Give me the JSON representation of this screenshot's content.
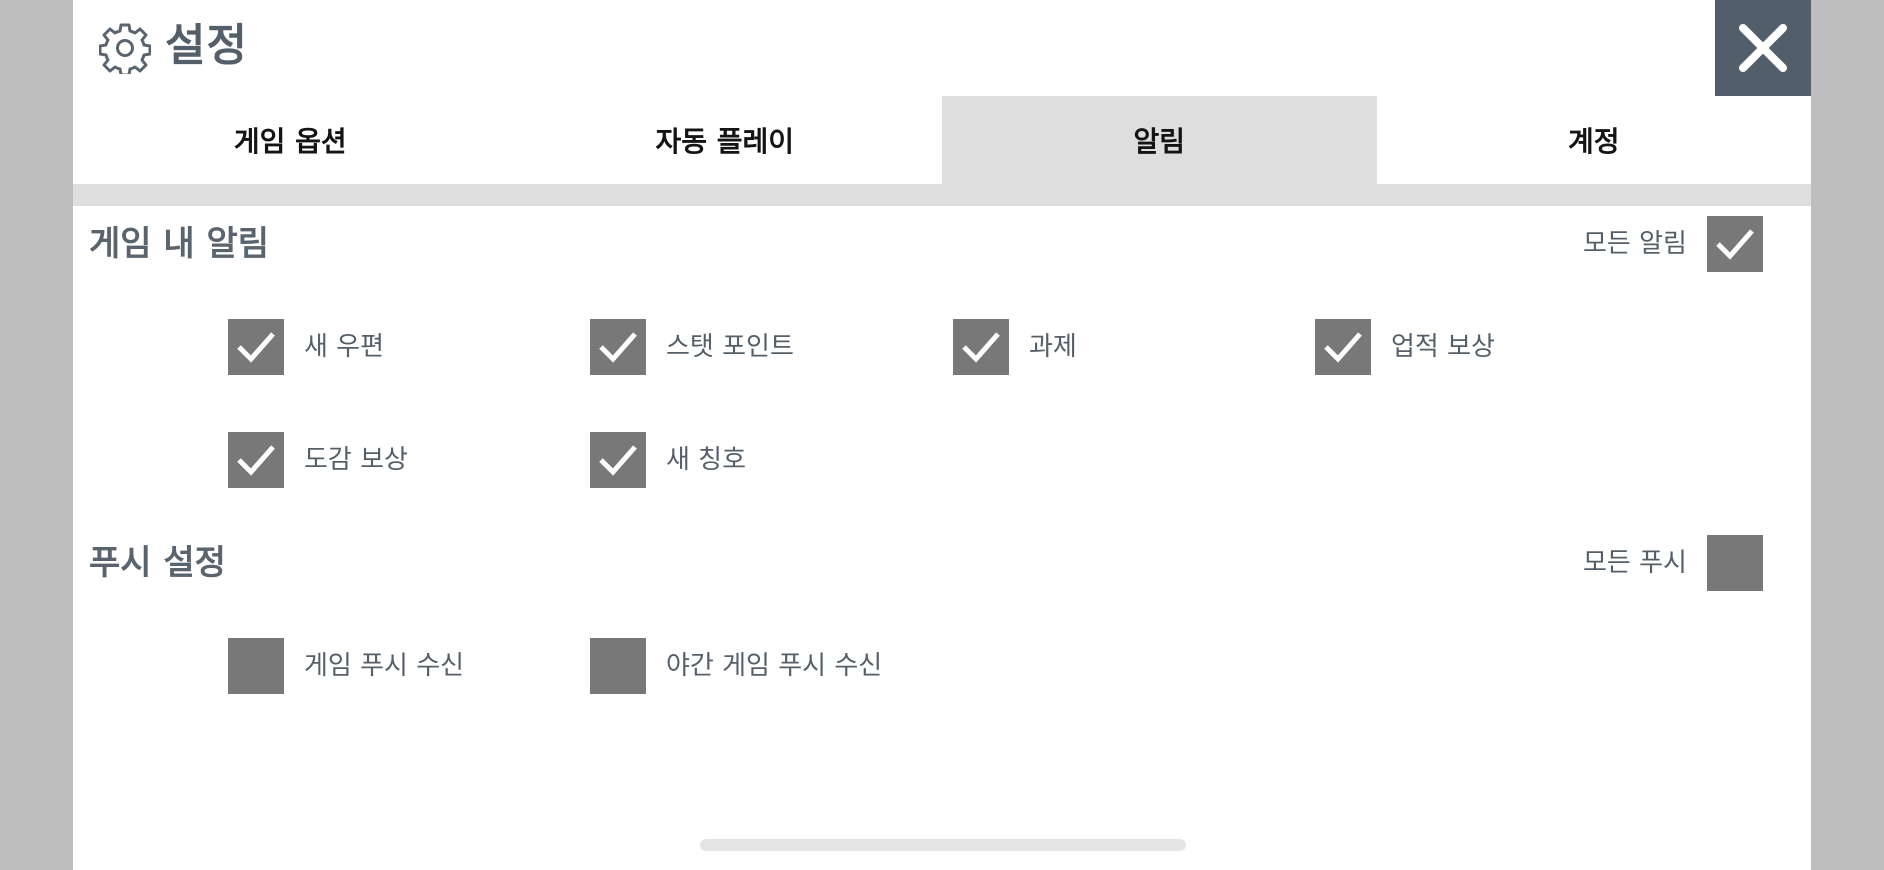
{
  "header": {
    "title": "설정",
    "gear_icon": "gear-icon",
    "close_icon": "close-icon"
  },
  "tabs": [
    {
      "label": "게임 옵션",
      "active": false
    },
    {
      "label": "자동 플레이",
      "active": false
    },
    {
      "label": "알림",
      "active": true
    },
    {
      "label": "계정",
      "active": false
    }
  ],
  "in_game_alerts": {
    "title": "게임 내 알림",
    "master": {
      "label": "모든 알림",
      "checked": true
    },
    "items": [
      {
        "label": "새 우편",
        "checked": true
      },
      {
        "label": "스탯 포인트",
        "checked": true
      },
      {
        "label": "과제",
        "checked": true
      },
      {
        "label": "업적 보상",
        "checked": true
      },
      {
        "label": "도감 보상",
        "checked": true
      },
      {
        "label": "새 칭호",
        "checked": true
      }
    ]
  },
  "push_settings": {
    "title": "푸시 설정",
    "master": {
      "label": "모든 푸시",
      "checked": false
    },
    "items": [
      {
        "label": "게임 푸시 수신",
        "checked": false
      },
      {
        "label": "야간 게임 푸시 수신",
        "checked": false
      }
    ]
  },
  "colors": {
    "background": "#bebebe",
    "panel": "#ffffff",
    "close_button": "#525e69",
    "checkbox": "#787878",
    "active_tab": "#dedede",
    "text": "#555f69"
  }
}
